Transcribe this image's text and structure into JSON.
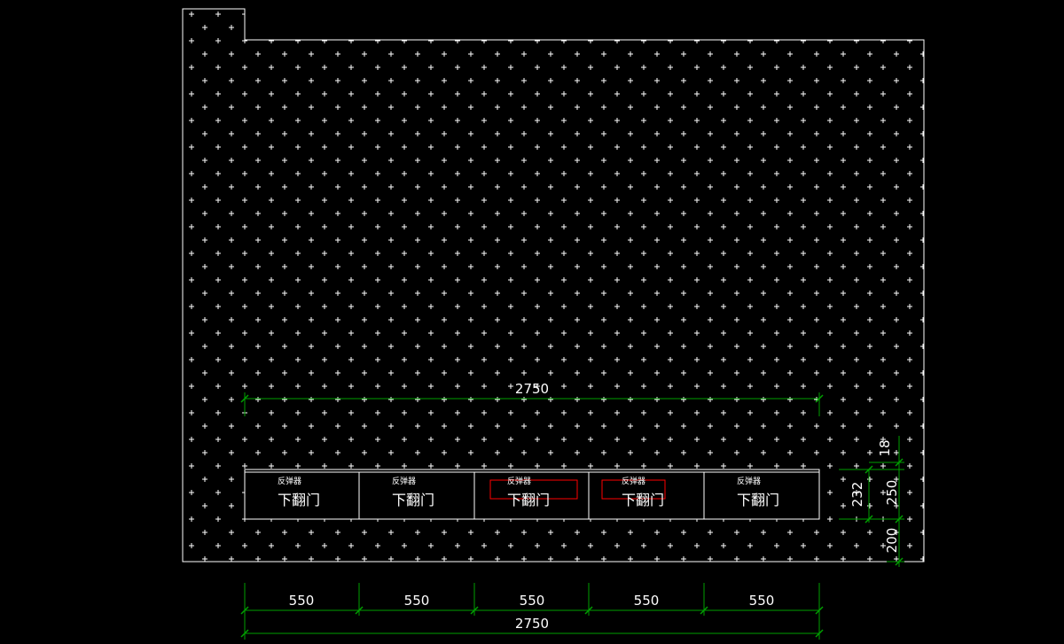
{
  "drawing": {
    "background": "#000000",
    "line_color": "#ffffff",
    "dimension_color": "#00a000",
    "highlight_color": "#ff0000"
  },
  "cabinets": {
    "count": 5,
    "items": [
      {
        "top_label": "反弹器",
        "main_label": "下翻门",
        "highlighted": false
      },
      {
        "top_label": "反弹器",
        "main_label": "下翻门",
        "highlighted": false
      },
      {
        "top_label": "反弹器",
        "main_label": "下翻门",
        "highlighted": true
      },
      {
        "top_label": "反弹器",
        "main_label": "下翻门",
        "highlighted": true
      },
      {
        "top_label": "反弹器",
        "main_label": "下翻门",
        "highlighted": false
      }
    ]
  },
  "dimensions": {
    "top_total": "2750",
    "bottom_segments": [
      "550",
      "550",
      "550",
      "550",
      "550"
    ],
    "bottom_total": "2750",
    "right_gap": "18",
    "right_inner": "232",
    "right_outer": "250",
    "right_bottom": "200"
  }
}
